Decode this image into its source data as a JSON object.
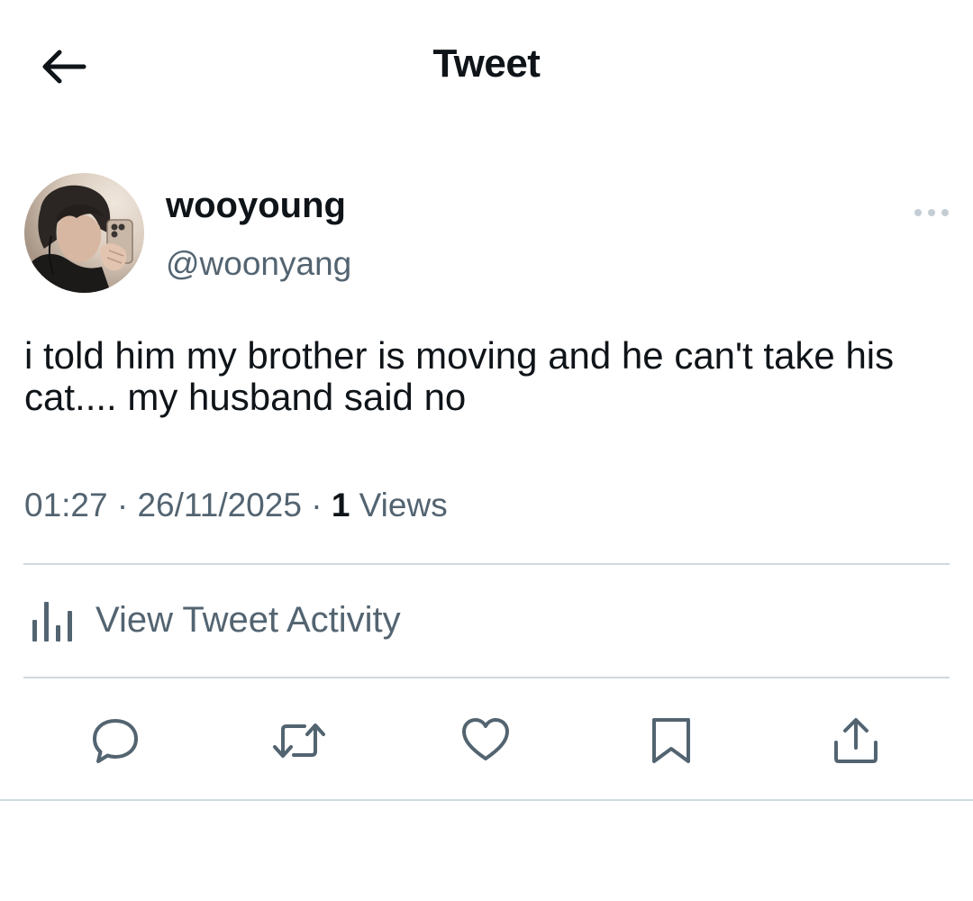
{
  "header": {
    "title": "Tweet",
    "back_icon": "arrow-left-icon"
  },
  "author": {
    "display_name": "wooyoung",
    "handle": "@woonyang"
  },
  "tweet": {
    "text": "i told him my brother is moving and he can't take his cat.... my husband said no",
    "time": "01:27",
    "separator": "·",
    "date": "26/11/2025",
    "views_count": "1",
    "views_label": "Views"
  },
  "activity": {
    "label": "View Tweet Activity",
    "icon": "bar-chart-icon"
  },
  "actions": {
    "icons": [
      "reply-icon",
      "retweet-icon",
      "like-icon",
      "bookmark-icon",
      "share-icon"
    ]
  },
  "colors": {
    "text_primary": "#0f1419",
    "text_secondary": "#536471",
    "divider": "#cfd9de"
  }
}
